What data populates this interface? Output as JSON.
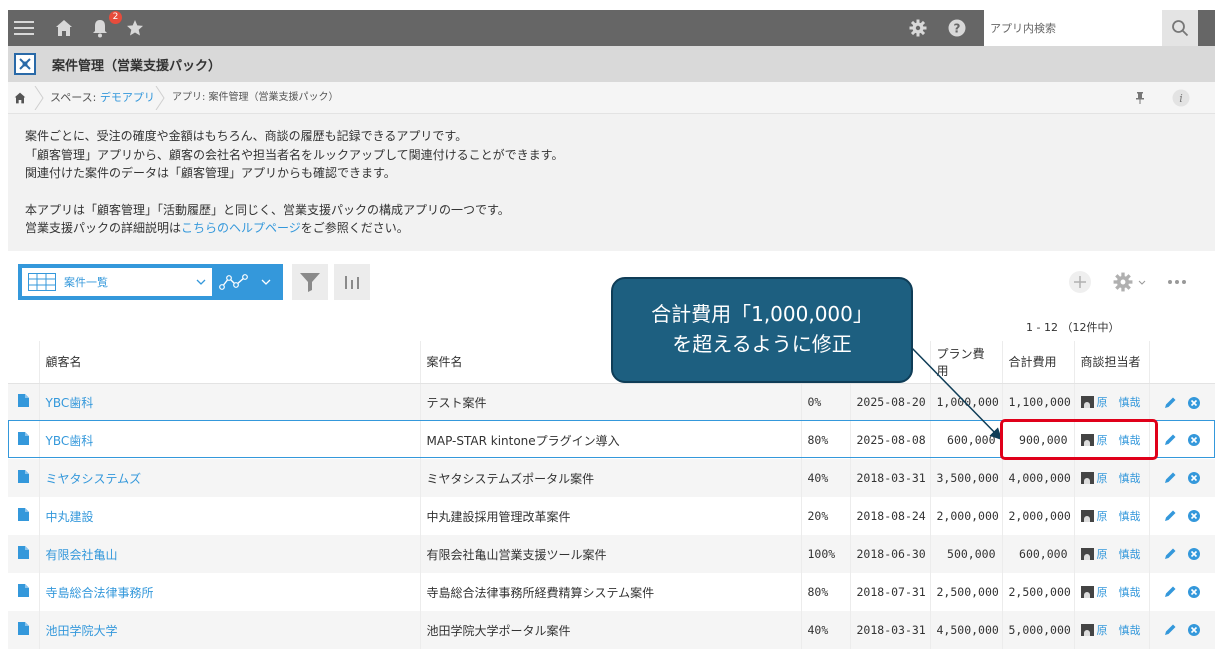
{
  "topbar": {
    "icons": [
      "menu-icon",
      "home-icon",
      "bell-icon",
      "star-icon",
      "gear-icon",
      "help-icon",
      "search-icon"
    ],
    "notification_count": "2",
    "search_placeholder": "アプリ内検索"
  },
  "app": {
    "title": "案件管理（営業支援パック）"
  },
  "breadcrumb": {
    "space_prefix": "スペース: ",
    "space_link": "デモアプリ",
    "app_path": "アプリ: 案件管理（営業支援パック）"
  },
  "description": {
    "line1": "案件ごとに、受注の確度や金額はもちろん、商談の履歴も記録できるアプリです。",
    "line2": "「顧客管理」アプリから、顧客の会社名や担当者名をルックアップして関連付けることができます。",
    "line3": "関連付けた案件のデータは「顧客管理」アプリからも確認できます。",
    "line4": "本アプリは「顧客管理」「活動履歴」と同じく、営業支援パックの構成アプリの一つです。",
    "line5_pre": "営業支援パックの詳細説明は",
    "line5_link": "こちらのヘルプページ",
    "line5_post": "をご参照ください。"
  },
  "toolbar": {
    "view_label": "案件一覧",
    "pager": "1 - 12 （12件中）"
  },
  "table": {
    "headers": {
      "customer": "顧客名",
      "deal": "案件名",
      "plan_cost": "プラン費用",
      "total_cost": "合計費用",
      "owner": "商談担当者"
    },
    "rows": [
      {
        "customer": "YBC歯科",
        "deal": "テスト案件",
        "prob": "0%",
        "date": "2025-08-20",
        "plan": "1,000,000",
        "total": "1,100,000",
        "owner": "原　慎哉"
      },
      {
        "customer": "YBC歯科",
        "deal": "MAP-STAR kintoneプラグイン導入",
        "prob": "80%",
        "date": "2025-08-08",
        "plan": "600,000",
        "total": "900,000",
        "owner": "原　慎哉"
      },
      {
        "customer": "ミヤタシステムズ",
        "deal": "ミヤタシステムズポータル案件",
        "prob": "40%",
        "date": "2018-03-31",
        "plan": "3,500,000",
        "total": "4,000,000",
        "owner": "原　慎哉"
      },
      {
        "customer": "中丸建設",
        "deal": "中丸建設採用管理改革案件",
        "prob": "20%",
        "date": "2018-08-24",
        "plan": "2,000,000",
        "total": "2,000,000",
        "owner": "原　慎哉"
      },
      {
        "customer": "有限会社亀山",
        "deal": "有限会社亀山営業支援ツール案件",
        "prob": "100%",
        "date": "2018-06-30",
        "plan": "500,000",
        "total": "600,000",
        "owner": "原　慎哉"
      },
      {
        "customer": "寺島総合法律事務所",
        "deal": "寺島総合法律事務所経費精算システム案件",
        "prob": "80%",
        "date": "2018-07-31",
        "plan": "2,500,000",
        "total": "2,500,000",
        "owner": "原　慎哉"
      },
      {
        "customer": "池田学院大学",
        "deal": "池田学院大学ポータル案件",
        "prob": "40%",
        "date": "2018-03-31",
        "plan": "4,500,000",
        "total": "5,000,000",
        "owner": "原　慎哉"
      }
    ]
  },
  "annotation": {
    "line1": "合計費用「1,000,000」",
    "line2": "を超えるように修正",
    "accent": "#1d5f80",
    "highlight": "#e0001a"
  }
}
